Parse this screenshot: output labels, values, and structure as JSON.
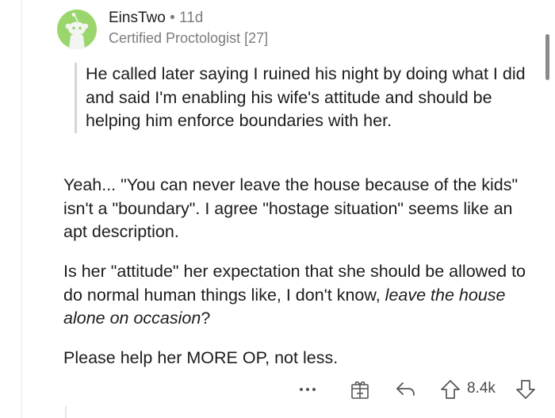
{
  "comment": {
    "author": "EinsTwo",
    "separator": "•",
    "age": "11d",
    "flair": "Certified Proctologist [27]",
    "quote": "He called later saying I ruined his night by doing what I did and said I'm enabling his wife's attitude and should be helping him enforce boundaries with her.",
    "paragraph_1": "Yeah... \"You can never leave the house because of the kids\" isn't a \"boundary\". I agree \"hostage situation\" seems like an apt description.",
    "paragraph_2_start": "Is her \"attitude\" her expectation that she should be allowed to do normal human things like, I don't know, ",
    "paragraph_2_italic": "leave the house alone on occasion",
    "paragraph_2_end": "?",
    "paragraph_3": "Please help her MORE OP, not less."
  },
  "actions": {
    "more_icon": "ellipsis-icon",
    "award_icon": "gift-icon",
    "reply_icon": "reply-arrow-icon",
    "upvote_icon": "upvote-arrow-icon",
    "score": "8.4k",
    "downvote_icon": "downvote-arrow-icon"
  },
  "colors": {
    "avatar_bg": "#9ad66c",
    "avatar_figure": "#f3f5f2",
    "text": "#1c1c1c",
    "muted": "#7c7c7c",
    "quote_bar": "#d3d6da"
  }
}
